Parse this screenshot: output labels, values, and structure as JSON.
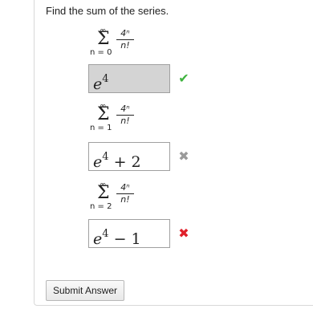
{
  "prompt": "Find the sum of the series.",
  "problems": [
    {
      "upper_limit": "∞",
      "lower_limit": "n = 0",
      "numerator": "4ⁿ",
      "denominator": "n!",
      "answer_base": "e",
      "answer_exp": "4",
      "answer_rest": "",
      "status": "correct",
      "mark_icon": "✔"
    },
    {
      "upper_limit": "∞",
      "lower_limit": "n = 1",
      "numerator": "4ⁿ",
      "denominator": "n!",
      "answer_base": "e",
      "answer_exp": "4",
      "answer_rest": " + 2",
      "status": "incorrect-grey",
      "mark_icon": "✖"
    },
    {
      "upper_limit": "∞",
      "lower_limit": "n = 2",
      "numerator": "4ⁿ",
      "denominator": "n!",
      "answer_base": "e",
      "answer_exp": "4",
      "answer_rest": " − 1",
      "status": "incorrect",
      "mark_icon": "✖"
    }
  ],
  "submit_label": "Submit Answer",
  "colors": {
    "correct_fill": "#d4d4d4",
    "check": "#3fb33f",
    "grey_x": "#9a9a9a",
    "red_x": "#e0202a"
  }
}
